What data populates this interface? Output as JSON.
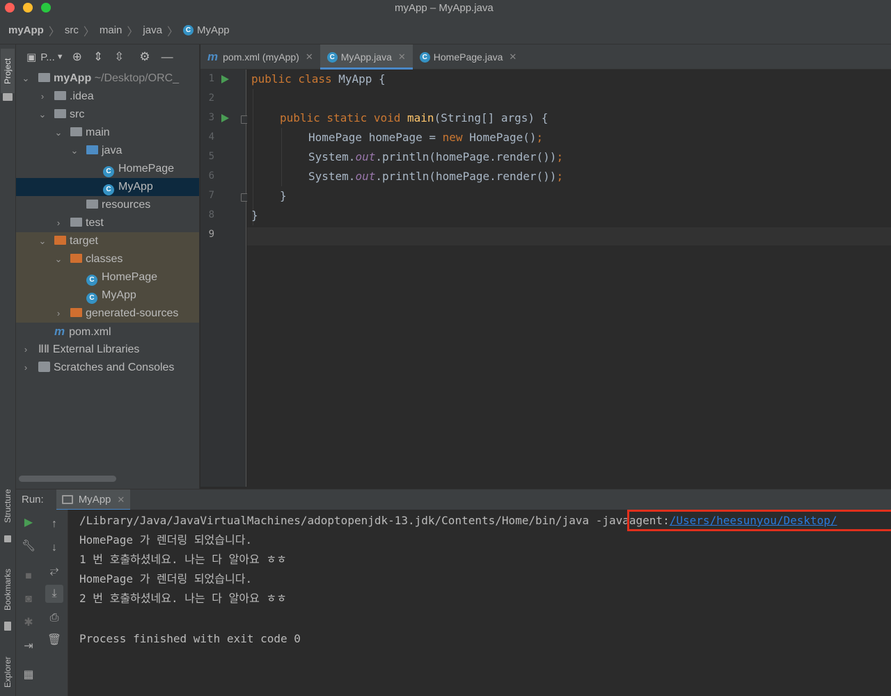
{
  "window": {
    "title": "myApp – MyApp.java"
  },
  "breadcrumb": [
    "myApp",
    "src",
    "main",
    "java",
    "MyApp"
  ],
  "left_strip": {
    "tabs": [
      "Project",
      "Structure",
      "Bookmarks",
      "Explorer"
    ]
  },
  "project_panel": {
    "view_label": "P...",
    "tree": [
      {
        "label": "myApp",
        "path": "~/Desktop/ORC_",
        "bold": true
      },
      {
        "label": ".idea"
      },
      {
        "label": "src"
      },
      {
        "label": "main"
      },
      {
        "label": "java"
      },
      {
        "label": "HomePage"
      },
      {
        "label": "MyApp"
      },
      {
        "label": "resources"
      },
      {
        "label": "test"
      },
      {
        "label": "target"
      },
      {
        "label": "classes"
      },
      {
        "label": "HomePage"
      },
      {
        "label": "MyApp"
      },
      {
        "label": "generated-sources"
      },
      {
        "label": "pom.xml"
      },
      {
        "label": "External Libraries"
      },
      {
        "label": "Scratches and Consoles"
      }
    ]
  },
  "editor": {
    "tabs": [
      {
        "label": "pom.xml (myApp)",
        "icon": "maven-icon",
        "active": false
      },
      {
        "label": "MyApp.java",
        "icon": "class-icon",
        "active": true
      },
      {
        "label": "HomePage.java",
        "icon": "class-icon",
        "active": false
      }
    ],
    "line_numbers": [
      "1",
      "2",
      "3",
      "4",
      "5",
      "6",
      "7",
      "8",
      "9"
    ],
    "code": {
      "l1": {
        "kw": "public class ",
        "rest": "MyApp {"
      },
      "l3": {
        "kw": "public static void ",
        "fn": "main",
        "rest": "(String[] args) {"
      },
      "l4": {
        "a": "HomePage homePage = ",
        "kw": "new ",
        "b": "HomePage()",
        "semi": ";"
      },
      "l5": {
        "a": "System.",
        "static": "out",
        "b": ".println(homePage.render())",
        "semi": ";"
      },
      "l6": {
        "a": "System.",
        "static": "out",
        "b": ".println(homePage.render())",
        "semi": ";"
      },
      "l7": "}",
      "l8": "}"
    }
  },
  "run_panel": {
    "label": "Run:",
    "tab_label": "MyApp",
    "console": {
      "cmd": "/Library/Java/JavaVirtualMachines/adoptopenjdk-13.jdk/Contents/Home/bin/java",
      "agent_flag": "-javaagent:",
      "agent_path": "/Users/heesunyou/Desktop/",
      "lines": [
        "HomePage 가 렌더링 되었습니다.",
        "1 번 호출하셨네요. 나는 다 알아요 ㅎㅎ",
        "HomePage 가 렌더링 되었습니다.",
        "2 번 호출하셨네요. 나는 다 알아요 ㅎㅎ",
        "",
        "Process finished with exit code 0"
      ]
    }
  },
  "colors": {
    "traffic_close": "#fe5f57",
    "traffic_min": "#febc2e",
    "traffic_max": "#28c840",
    "accent": "#4a88c7",
    "highlight_box": "#e1301c"
  }
}
